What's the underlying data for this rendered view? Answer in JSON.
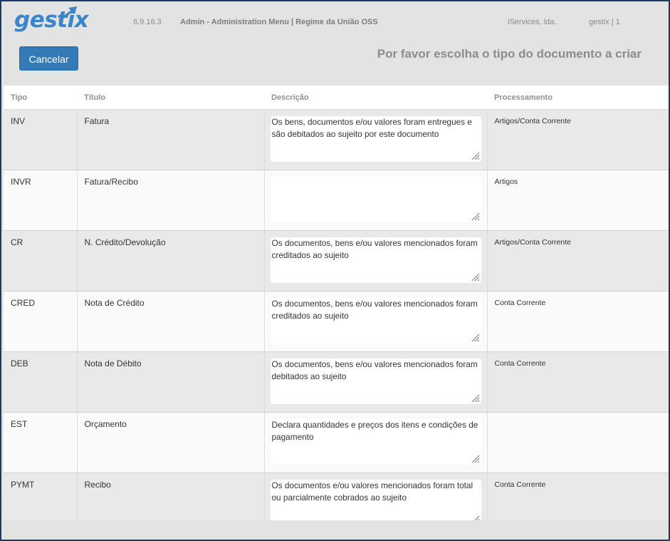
{
  "header": {
    "logo_text": "gestix",
    "version": "6.9.16.3",
    "title": "Admin - Administration Menu | Regime da União OSS",
    "company": "iServices, lda.",
    "user": "gestix | 1"
  },
  "actions": {
    "cancel_label": "Cancelar"
  },
  "page_heading": "Por favor escolha o tipo do documento a criar",
  "table": {
    "columns": [
      "Tipo",
      "Título",
      "Descrição",
      "Processamento"
    ],
    "rows": [
      {
        "tipo": "INV",
        "titulo": "Fatura",
        "descricao": "Os bens, documentos e/ou valores foram entregues e são debitados ao sujeito por este documento",
        "processamento": "Artigos/Conta Corrente"
      },
      {
        "tipo": "INVR",
        "titulo": "Fatura/Recibo",
        "descricao": "",
        "processamento": "Artigos"
      },
      {
        "tipo": "CR",
        "titulo": "N. Crédito/Devolução",
        "descricao": "Os documentos, bens e/ou valores mencionados foram creditados ao sujeito",
        "processamento": "Artigos/Conta Corrente"
      },
      {
        "tipo": "CRED",
        "titulo": "Nota de Crédito",
        "descricao": "Os documentos, bens e/ou valores mencionados foram creditados ao sujeito",
        "processamento": "Conta Corrente"
      },
      {
        "tipo": "DEB",
        "titulo": "Nota de Débito",
        "descricao": "Os documentos, bens e/ou valores mencionados foram debitados ao sujeito",
        "processamento": "Conta Corrente"
      },
      {
        "tipo": "EST",
        "titulo": "Orçamento",
        "descricao": "Declara quantidades e preços dos itens e condições de pagamento",
        "processamento": ""
      },
      {
        "tipo": "PYMT",
        "titulo": "Recibo",
        "descricao": "Os documentos e/ou valores mencionados foram total ou parcialmente cobrados ao sujeito",
        "processamento": "Conta Corrente"
      }
    ]
  },
  "colors": {
    "brand": "#3a86c8",
    "button": "#337ab7",
    "frame": "#1f3a5c",
    "row_odd": "#e9e9e9",
    "row_even": "#fafafa"
  },
  "icons": {
    "logo_arrow": "arrow-up-right-icon",
    "resize_grip": "resize-grip-icon"
  }
}
